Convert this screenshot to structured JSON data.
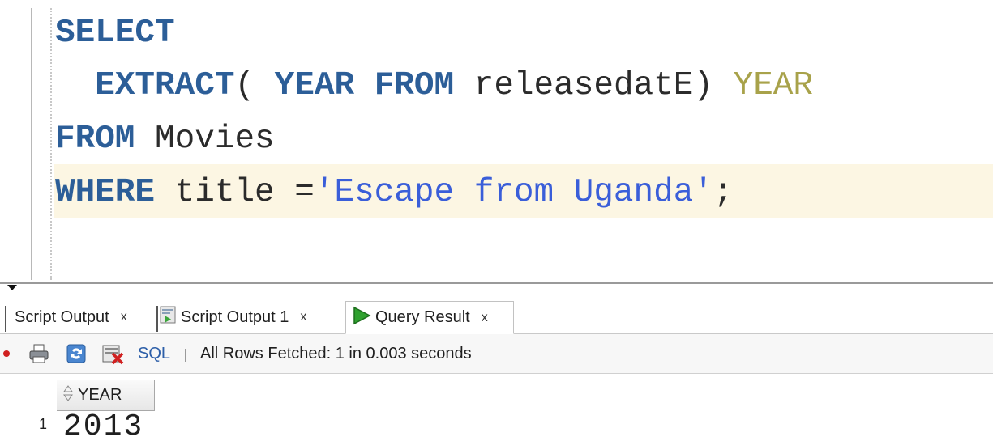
{
  "editor": {
    "line1": {
      "kw": "SELECT"
    },
    "line2": {
      "kw1": "EXTRACT",
      "p1": "( ",
      "kw2": "YEAR",
      "kw3": "FROM",
      "ident": " releasedatE) ",
      "alias": "YEAR"
    },
    "line3": {
      "kw": "FROM",
      "ident": " Movies"
    },
    "line4": {
      "kw": "WHERE",
      "ident": " title =",
      "str": "'Escape from Uganda'",
      "end": ";"
    }
  },
  "tabs": [
    {
      "label": "Script Output",
      "icon": "script-icon",
      "close": "x"
    },
    {
      "label": "Script Output 1",
      "icon": "script-icon",
      "close": "x"
    },
    {
      "label": "Query Result",
      "icon": "run-arrow-icon",
      "close": "x"
    }
  ],
  "toolbar": {
    "sql_label": "SQL",
    "status": "All Rows Fetched: 1 in 0.003 seconds"
  },
  "grid": {
    "columns": [
      "YEAR"
    ],
    "rows": [
      {
        "num": "1",
        "values": [
          "2013"
        ]
      }
    ]
  },
  "colors": {
    "keyword": "#2c5e98",
    "string": "#3a5ed9",
    "alias": "#a8a24a",
    "current_line": "#fcf6e3",
    "run_arrow": "#2fa12f"
  }
}
